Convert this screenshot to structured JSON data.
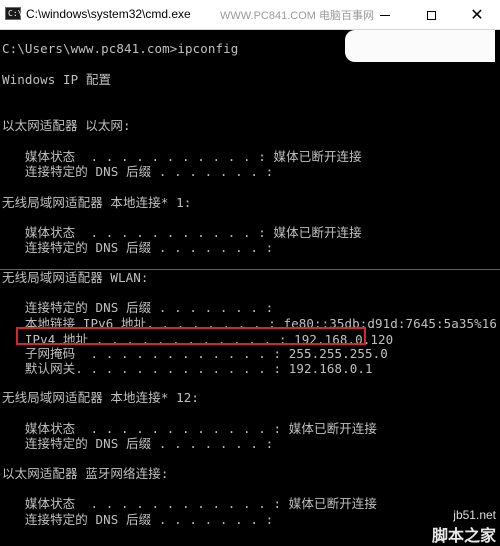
{
  "window": {
    "title": "C:\\windows\\system32\\cmd.exe",
    "watermark": "WWW.PC841.COM 电脑百事网"
  },
  "console_lines": [
    "C:\\Users\\www.pc841.com>ipconfig",
    "Windows IP 配置",
    "以太网适配器 以太网:",
    "   媒体状态  . . . . . . . . . . . : 媒体已断开连接",
    "   连接特定的 DNS 后缀 . . . . . . . :",
    "无线局域网适配器 本地连接* 1:",
    "   媒体状态  . . . . . . . . . . . : 媒体已断开连接",
    "   连接特定的 DNS 后缀 . . . . . . . :",
    "无线局域网适配器 WLAN:",
    "   连接特定的 DNS 后缀 . . . . . . . :",
    "   本地链接 IPv6 地址. . . . . . . . : fe80::35db:d91d:7645:5a35%16",
    "   IPv4 地址 . . . . . . . . . . . . : 192.168.0.120",
    "   子网掩码  . . . . . . . . . . . . : 255.255.255.0",
    "   默认网关. . . . . . . . . . . . . : 192.168.0.1",
    "无线局域网适配器 本地连接* 12:",
    "   媒体状态  . . . . . . . . . . . . : 媒体已断开连接",
    "   连接特定的 DNS 后缀 . . . . . . . :",
    "以太网适配器 蓝牙网络连接:",
    "   媒体状态  . . . . . . . . . . . . : 媒体已断开连接",
    "   连接特定的 DNS 后缀 . . . . . . . :"
  ],
  "bottom_watermark": {
    "site": "jb51.net",
    "name": "脚本之家"
  },
  "colors": {
    "console_bg": "#000000",
    "console_text": "#c0c0c0",
    "highlight": "#d42828"
  }
}
